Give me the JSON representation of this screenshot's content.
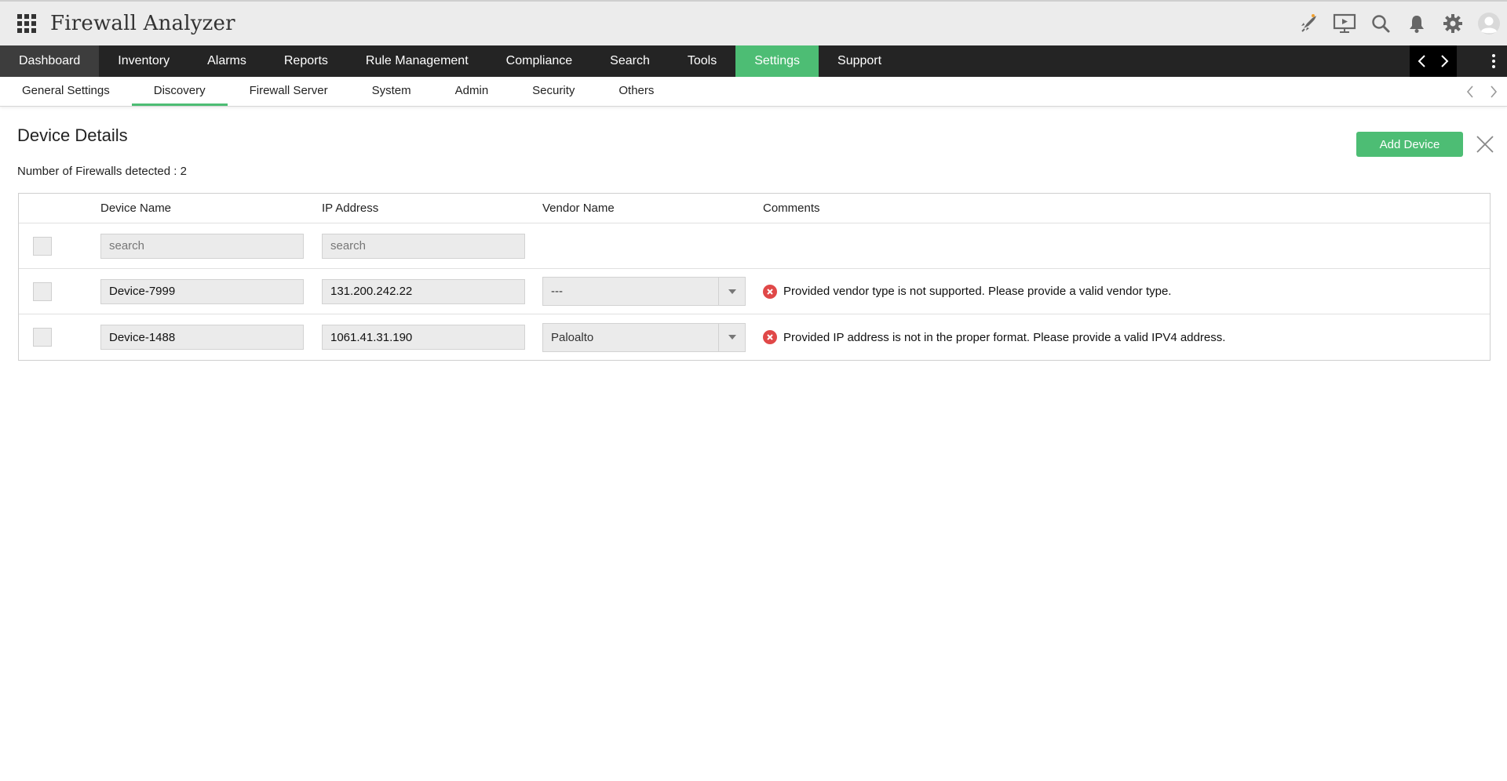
{
  "app": {
    "title": "Firewall Analyzer",
    "header_icons": [
      "rocket-icon",
      "presentation-icon",
      "search-icon",
      "bell-icon",
      "gear-icon",
      "user-avatar-icon"
    ]
  },
  "main_nav": {
    "items": [
      "Dashboard",
      "Inventory",
      "Alarms",
      "Reports",
      "Rule Management",
      "Compliance",
      "Search",
      "Tools",
      "Settings",
      "Support"
    ],
    "active": "Settings"
  },
  "sub_nav": {
    "items": [
      "General Settings",
      "Discovery",
      "Firewall Server",
      "System",
      "Admin",
      "Security",
      "Others"
    ],
    "active": "Discovery"
  },
  "page": {
    "title": "Device Details",
    "count_text": "Number of Firewalls detected : 2",
    "add_button": "Add Device"
  },
  "table": {
    "columns": [
      "Device Name",
      "IP Address",
      "Vendor Name",
      "Comments"
    ],
    "search_placeholder": "search",
    "rows": [
      {
        "device_name": "Device-7999",
        "ip": "131.200.242.22",
        "vendor": "---",
        "comment": "Provided vendor type is not supported. Please provide a valid vendor type."
      },
      {
        "device_name": "Device-1488",
        "ip": "1061.41.31.190",
        "vendor": "Paloalto",
        "comment": "Provided IP address is not in the proper format. Please provide a valid IPV4 address."
      }
    ]
  },
  "colors": {
    "accent": "#4dbd74",
    "nav_bg": "#242424",
    "header_bg": "#ececec",
    "error": "#e04848"
  }
}
